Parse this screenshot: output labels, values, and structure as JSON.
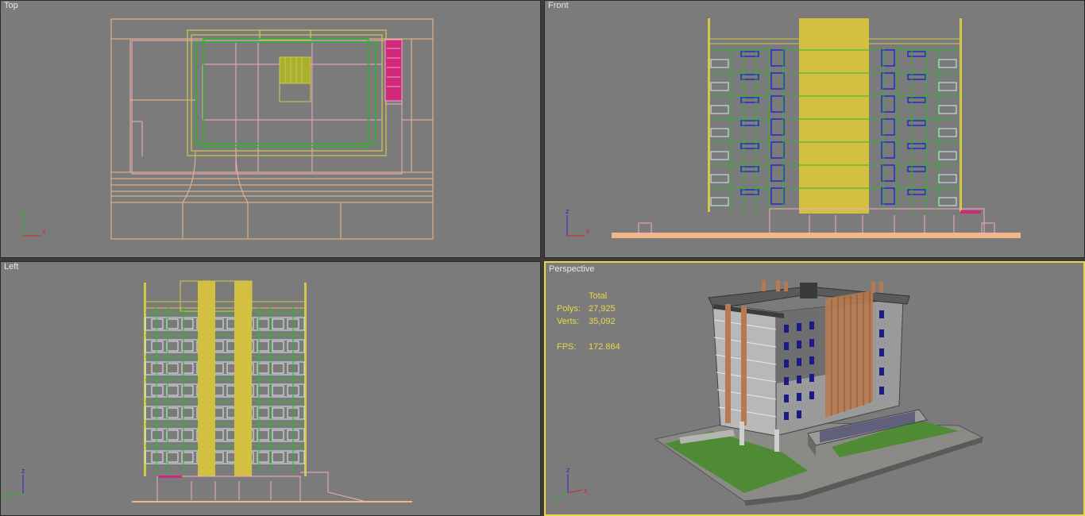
{
  "viewports": {
    "top": {
      "label": "Top"
    },
    "front": {
      "label": "Front"
    },
    "left": {
      "label": "Left"
    },
    "perspective": {
      "label": "Perspective"
    }
  },
  "stats": {
    "header": "Total",
    "polys_label": "Polys:",
    "polys_value": "27,925",
    "verts_label": "Verts:",
    "verts_value": "35,092",
    "fps_label": "FPS:",
    "fps_value": "172.864"
  },
  "axes": {
    "x": "x",
    "y": "y",
    "z": "z"
  },
  "colors": {
    "viewport_bg": "#7b7b7b",
    "active_border": "#e8d84a",
    "stats_text": "#e8d84a",
    "wire_peach": "#f0b88a",
    "wire_yellow": "#d4c84a",
    "wire_green": "#2db42d",
    "wire_pink": "#f0a8c8",
    "wire_blue": "#2828c8",
    "wire_cyan": "#c8f0f0",
    "wire_magenta": "#d0287a",
    "column_fill": "#d4c040"
  }
}
